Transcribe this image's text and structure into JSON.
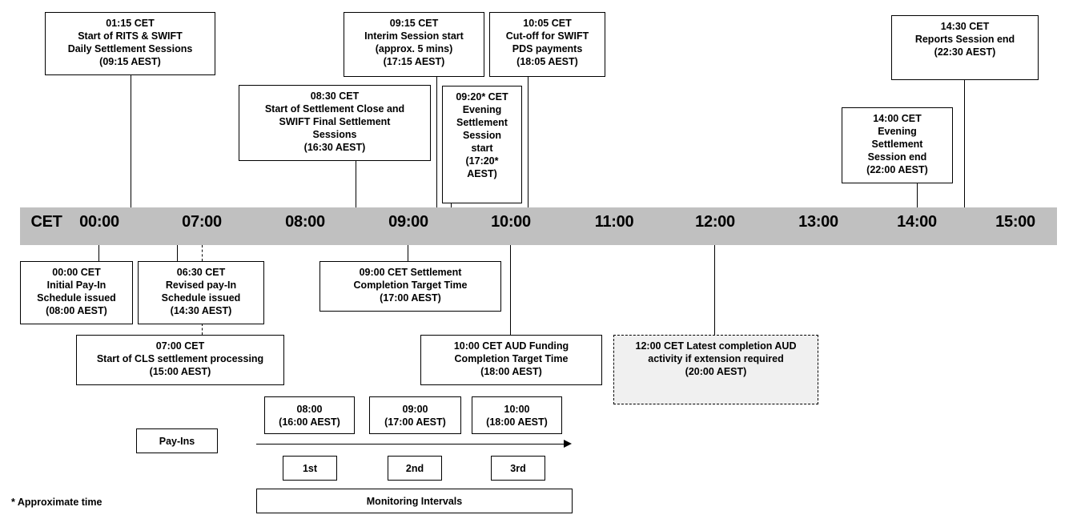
{
  "timeline": {
    "label": "CET",
    "ticks": [
      "00:00",
      "07:00",
      "08:00",
      "09:00",
      "10:00",
      "11:00",
      "12:00",
      "13:00",
      "14:00",
      "15:00"
    ],
    "band_color": "#c0c0c0"
  },
  "events_above": [
    {
      "lines": [
        "01:15 CET",
        "Start of RITS & SWIFT",
        "Daily Settlement Sessions",
        "(09:15 AEST)"
      ]
    },
    {
      "lines": [
        "08:30 CET",
        "Start of Settlement Close and",
        "SWIFT Final Settlement",
        "Sessions",
        "(16:30 AEST)"
      ]
    },
    {
      "lines": [
        "09:15 CET",
        "Interim Session start",
        "(approx. 5 mins)",
        "(17:15 AEST)"
      ]
    },
    {
      "lines": [
        "09:20* CET",
        "Evening",
        "Settlement",
        "Session",
        "start",
        "(17:20*",
        "AEST)"
      ]
    },
    {
      "lines": [
        "10:05 CET",
        "Cut-off for SWIFT",
        "PDS payments",
        "(18:05 AEST)"
      ]
    },
    {
      "lines": [
        "14:00 CET",
        "Evening",
        "Settlement",
        "Session end",
        "(22:00 AEST)"
      ]
    },
    {
      "lines": [
        "14:30 CET",
        "Reports Session end",
        "(22:30 AEST)"
      ]
    }
  ],
  "events_below": [
    {
      "lines": [
        "00:00 CET",
        "Initial Pay-In",
        "Schedule issued",
        "(08:00 AEST)"
      ]
    },
    {
      "lines": [
        "06:30 CET",
        "Revised pay-In",
        "Schedule issued",
        "(14:30 AEST)"
      ]
    },
    {
      "lines": [
        "07:00 CET",
        "Start of CLS settlement processing",
        "(15:00 AEST)"
      ]
    },
    {
      "lines": [
        "09:00 CET Settlement",
        "Completion Target Time",
        "(17:00 AEST)"
      ]
    },
    {
      "lines": [
        "10:00 CET AUD Funding",
        "Completion Target Time",
        "(18:00 AEST)"
      ]
    },
    {
      "lines": [
        "12:00 CET Latest completion AUD",
        "activity if extension required",
        "(20:00 AEST)"
      ],
      "dashed": true
    }
  ],
  "pay_ins": {
    "label": "Pay-Ins",
    "times": [
      {
        "lines": [
          "08:00",
          "(16:00 AEST)"
        ]
      },
      {
        "lines": [
          "09:00",
          "(17:00 AEST)"
        ]
      },
      {
        "lines": [
          "10:00",
          "(18:00 AEST)"
        ]
      }
    ],
    "intervals": [
      "1st",
      "2nd",
      "3rd"
    ],
    "intervals_label": "Monitoring Intervals"
  },
  "footnote": "* Approximate time"
}
